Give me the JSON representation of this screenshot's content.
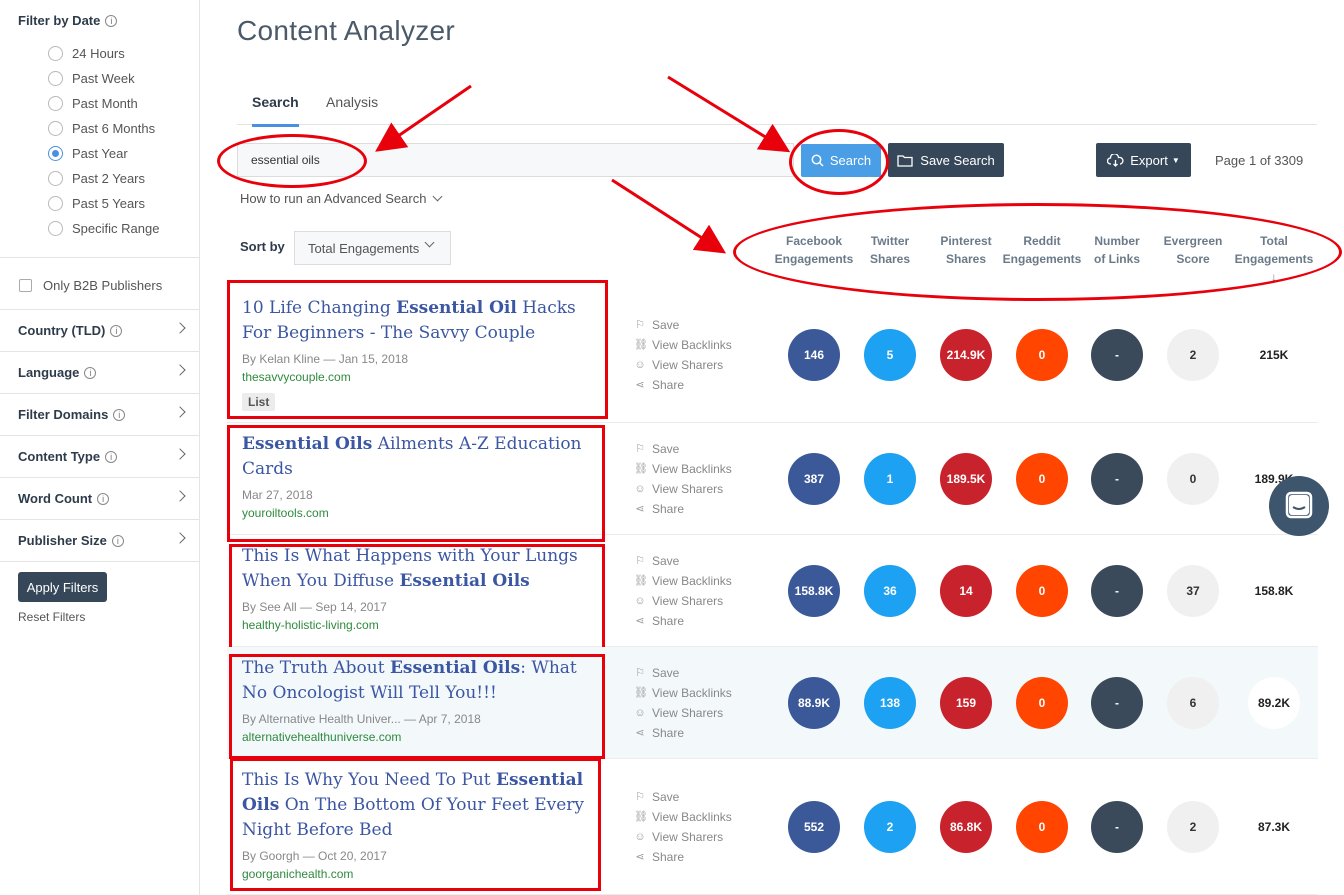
{
  "sidebar": {
    "filter_by_date": "Filter by Date",
    "date_options": [
      "24 Hours",
      "Past Week",
      "Past Month",
      "Past 6 Months",
      "Past Year",
      "Past 2 Years",
      "Past 5 Years",
      "Specific Range"
    ],
    "selected_date": "Past Year",
    "b2b_label": "Only B2B Publishers",
    "facets": [
      "Country (TLD)",
      "Language",
      "Filter Domains",
      "Content Type",
      "Word Count",
      "Publisher Size"
    ],
    "apply_label": "Apply Filters",
    "reset_label": "Reset Filters"
  },
  "main": {
    "title": "Content Analyzer",
    "tabs": [
      {
        "label": "Search",
        "active": true
      },
      {
        "label": "Analysis",
        "active": false
      }
    ],
    "search_value": "essential oils",
    "search_button": "Search",
    "save_search_button": "Save Search",
    "export_button": "Export",
    "page_info": "Page 1 of 3309",
    "advanced_link": "How to run an Advanced Search",
    "sort_label": "Sort by",
    "sort_value": "Total Engagements",
    "columns": [
      {
        "l1": "Facebook",
        "l2": "Engagements"
      },
      {
        "l1": "Twitter",
        "l2": "Shares"
      },
      {
        "l1": "Pinterest",
        "l2": "Shares"
      },
      {
        "l1": "Reddit",
        "l2": "Engagements"
      },
      {
        "l1": "Number",
        "l2": "of Links"
      },
      {
        "l1": "Evergreen",
        "l2": "Score"
      },
      {
        "l1": "Total",
        "l2": "Engagements",
        "sort_arrow": "↓"
      }
    ],
    "actions": [
      "Save",
      "View Backlinks",
      "View Sharers",
      "Share"
    ]
  },
  "articles": [
    {
      "title_html_parts": [
        [
          "10 Life Changing ",
          false
        ],
        [
          "Essential Oil",
          true
        ],
        [
          " Hacks For Beginners - The Savvy Couple",
          false
        ]
      ],
      "meta": "By Kelan Kline — Jan 15, 2018",
      "domain": "thesavvycouple.com",
      "tag": "List",
      "metrics": [
        "146",
        "5",
        "214.9K",
        "0",
        "-",
        "2",
        "215K"
      ]
    },
    {
      "title_html_parts": [
        [
          "Essential Oils",
          true
        ],
        [
          " Ailments A-Z Education Cards",
          false
        ]
      ],
      "meta": "Mar 27, 2018",
      "domain": "youroiltools.com",
      "tag": "",
      "metrics": [
        "387",
        "1",
        "189.5K",
        "0",
        "-",
        "0",
        "189.9K"
      ]
    },
    {
      "title_html_parts": [
        [
          "This Is What Happens with Your Lungs When You Diffuse ",
          false
        ],
        [
          "Essential Oils",
          true
        ]
      ],
      "meta": "By See All — Sep 14, 2017",
      "domain": "healthy-holistic-living.com",
      "tag": "",
      "metrics": [
        "158.8K",
        "36",
        "14",
        "0",
        "-",
        "37",
        "158.8K"
      ]
    },
    {
      "title_html_parts": [
        [
          "The Truth About ",
          false
        ],
        [
          "Essential Oils",
          true
        ],
        [
          ": What No Oncologist Will Tell You!!!",
          false
        ]
      ],
      "meta": "By Alternative Health Univer... — Apr 7, 2018",
      "domain": "alternativehealthuniverse.com",
      "tag": "",
      "metrics": [
        "88.9K",
        "138",
        "159",
        "0",
        "-",
        "6",
        "89.2K"
      ]
    },
    {
      "title_html_parts": [
        [
          "This Is Why You Need To Put ",
          false
        ],
        [
          "Essential Oils",
          true
        ],
        [
          " On The Bottom Of Your Feet Every Night Before Bed",
          false
        ]
      ],
      "meta": "By Goorgh — Oct 20, 2017",
      "domain": "goorganichealth.com",
      "tag": "",
      "metrics": [
        "552",
        "2",
        "86.8K",
        "0",
        "-",
        "2",
        "87.3K"
      ]
    }
  ],
  "colors": {
    "accent": "#4a90e2",
    "dark_button": "#36475a",
    "annotation_red": "#e8000b",
    "facebook": "#3b5998",
    "twitter": "#1da1f2",
    "pinterest": "#c8232c",
    "reddit": "#ff4500"
  }
}
